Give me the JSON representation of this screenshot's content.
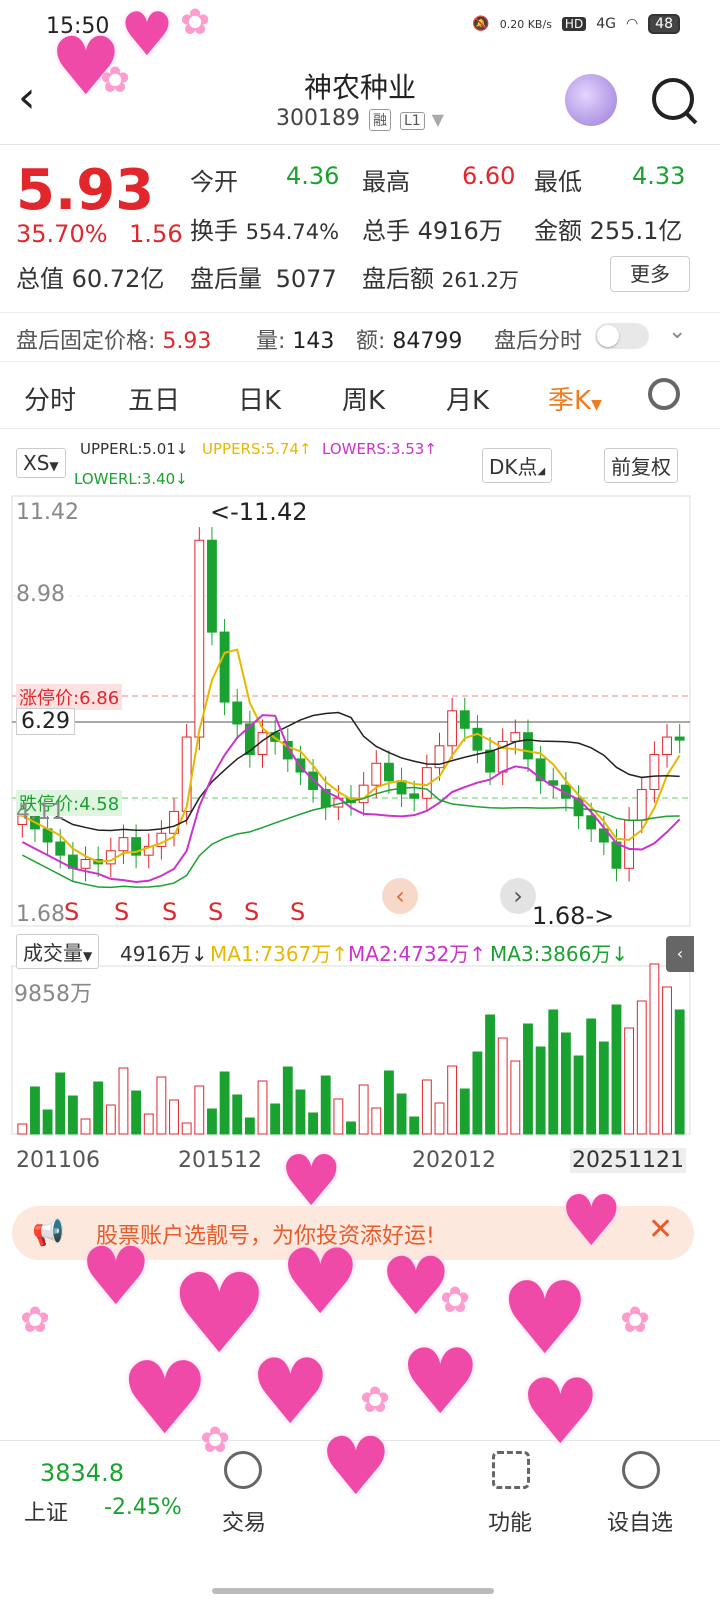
{
  "status": {
    "time": "15:50",
    "net": "0.20 KB/s",
    "hd": "HD",
    "net_type": "4G",
    "battery": "48"
  },
  "header": {
    "title": "神农种业",
    "code": "300189",
    "tag1": "融",
    "tag2": "L1"
  },
  "quote": {
    "price": "5.93",
    "change_pct": "35.70%",
    "change": "1.56",
    "open_label": "今开",
    "open": "4.36",
    "high_label": "最高",
    "high": "6.60",
    "low_label": "最低",
    "low": "4.33",
    "turnover_label": "换手",
    "turnover": "554.74%",
    "vol_label": "总手",
    "vol": "4916万",
    "amount_label": "金额",
    "amount": "255.1亿",
    "cap_label": "总值",
    "cap": "60.72亿",
    "ah_vol_label": "盘后量",
    "ah_vol": "5077",
    "ah_amount_label": "盘后额",
    "ah_amount": "261.2万",
    "more": "更多"
  },
  "afterhours": {
    "label": "盘后固定价格:",
    "price": "5.93",
    "vol_label": "量:",
    "vol": "143",
    "amt_label": "额:",
    "amt": "84799",
    "toggle_label": "盘后分时"
  },
  "tabs": [
    "分时",
    "五日",
    "日K",
    "周K",
    "月K",
    "季K"
  ],
  "active_tab": "季K",
  "chart_controls": {
    "indicator": "XS",
    "upperl": "UPPERL:5.01↓",
    "uppers": "UPPERS:5.74↑",
    "lowers": "LOWERS:3.53↑",
    "lowerl": "LOWERL:3.40↓",
    "dk": "DK点",
    "fq": "前复权",
    "y_labels": [
      "11.42",
      "8.98",
      "6.29",
      "4.11",
      "1.68"
    ],
    "limit_up": "涨停价:6.86",
    "limit_down": "跌停价:4.58",
    "max_note": "<-11.42",
    "min_note": "1.68->",
    "signals": [
      "S",
      "S",
      "S",
      "S",
      "S",
      "S"
    ],
    "volume_label": "成交量",
    "vol_value": "4916万↓",
    "ma1": "MA1:7367万↑",
    "ma2": "MA2:4732万↑",
    "ma3": "MA3:3866万↓",
    "vol_axis": "9858万",
    "dates": [
      "201106",
      "201512",
      "202012",
      "20251121"
    ]
  },
  "chart_data": {
    "type": "candlestick",
    "period": "quarterly",
    "price_axis": [
      1.68,
      4.11,
      6.29,
      8.98,
      11.42
    ],
    "high": 11.42,
    "low": 1.68,
    "last_price_line": 6.29,
    "limit_up": 6.86,
    "limit_down": 4.58,
    "x_labels": [
      "201106",
      "201512",
      "202012",
      "20251121"
    ],
    "volume_axis_max": "9858万"
  },
  "banner": {
    "text": "股票账户选靓号，为你投资添好运!"
  },
  "bottom": {
    "index_value": "3834.8",
    "index_name": "上证",
    "index_change": "-2.45%",
    "trade": "交易",
    "func": "功能",
    "watch": "设自选"
  },
  "colors": {
    "up": "#e1262c",
    "down": "#1aa231",
    "accent": "#f07b20",
    "ma1": "#e6b800",
    "ma2": "#cc33cc",
    "ma3": "#1aa231"
  }
}
